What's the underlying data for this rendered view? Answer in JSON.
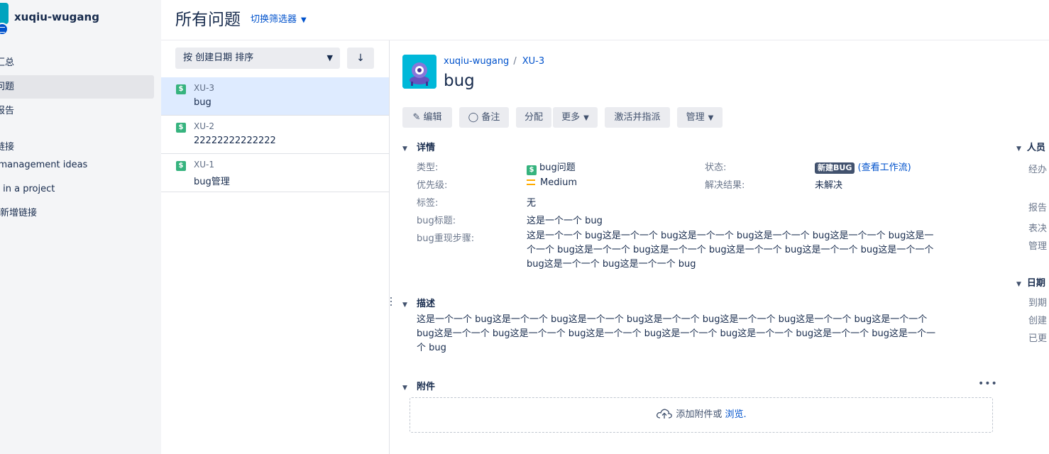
{
  "sidebar": {
    "project_name": "xuqiu-wugang",
    "items": [
      {
        "label": "汇总"
      },
      {
        "label": "问题"
      },
      {
        "label": "报告"
      }
    ],
    "shortcuts_heading": "链接",
    "shortcuts": [
      {
        "label": "Product management ideas"
      },
      {
        "label": "Planning in a project"
      },
      {
        "label": "添加新增链接"
      }
    ]
  },
  "header": {
    "title": "所有问题",
    "filter_switch": "切换筛选器"
  },
  "list": {
    "sort_label": "按 创建日期 排序",
    "issues": [
      {
        "key": "XU-3",
        "summary": "bug"
      },
      {
        "key": "XU-2",
        "summary": "22222222222222"
      },
      {
        "key": "XU-1",
        "summary": "bug管理"
      }
    ]
  },
  "detail": {
    "breadcrumb_project": "xuqiu-wugang",
    "breadcrumb_key": "XU-3",
    "title": "bug",
    "buttons": {
      "edit": "编辑",
      "comment": "备注",
      "assign": "分配",
      "more": "更多",
      "activate": "激活并指派",
      "admin": "管理"
    },
    "details": {
      "heading": "详情",
      "type_label": "类型:",
      "type_value": "bug问题",
      "priority_label": "优先级:",
      "priority_value": "Medium",
      "labels_label": "标签:",
      "labels_value": "无",
      "bug_title_label": "bug标题:",
      "bug_title_value": "这是一个一个 bug",
      "repro_label": "bug重现步骤:",
      "repro_lines": [
        "这是一个一个 bug这是一个一个 bug这是一个一个 bug这是一个一个 bug这是一个一个 bug这是一",
        "个一个 bug这是一个一个 bug这是一个一个 bug这是一个一个 bug这是一个一个 bug这是一个一个",
        "bug这是一个一个 bug这是一个一个 bug"
      ],
      "status_label": "状态:",
      "status_value": "新建BUG",
      "workflow_link": "(查看工作流)",
      "resolution_label": "解决结果:",
      "resolution_value": "未解决"
    },
    "description": {
      "heading": "描述",
      "lines": [
        "这是一个一个 bug这是一个一个 bug这是一个一个 bug这是一个一个 bug这是一个一个 bug这是一个一个 bug这是一个一个",
        "bug这是一个一个 bug这是一个一个 bug这是一个一个 bug这是一个一个 bug这是一个一个 bug这是一个一个 bug这是一个一",
        "个 bug"
      ]
    },
    "attachments": {
      "heading": "附件",
      "more": "•••",
      "drop_text": "添加附件或",
      "browse": "浏览."
    }
  },
  "right": {
    "people_heading": "人员",
    "assignee_label": "经办",
    "reporter_label": "报告",
    "vote_label": "表决",
    "admin_label": "管理",
    "dates_heading": "日期",
    "due_label": "到期",
    "created_label": "创建",
    "updated_label": "已更"
  },
  "colors": {
    "link": "#0052cc",
    "bug_type": "#36b37e",
    "priority_medium": "#ffab00",
    "status_lozenge": "#42526e",
    "selected_row": "#deebff"
  }
}
